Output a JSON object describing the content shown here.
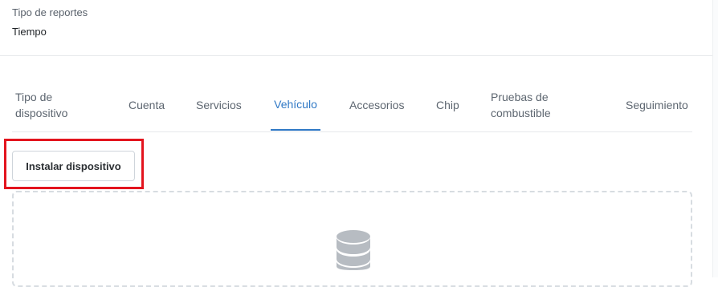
{
  "report": {
    "label": "Tipo de reportes",
    "value": "Tiempo"
  },
  "tabs": [
    {
      "label": "Tipo de\ndispositivo",
      "active": false
    },
    {
      "label": "Cuenta",
      "active": false
    },
    {
      "label": "Servicios",
      "active": false
    },
    {
      "label": "Vehículo",
      "active": true
    },
    {
      "label": "Accesorios",
      "active": false
    },
    {
      "label": "Chip",
      "active": false
    },
    {
      "label": "Pruebas de\ncombustible",
      "active": false
    },
    {
      "label": "Seguimiento",
      "active": false
    }
  ],
  "actions": {
    "install_label": "Instalar dispositivo"
  },
  "empty_state": {
    "icon": "database-icon"
  },
  "colors": {
    "accent": "#2f78c5",
    "highlight": "#e3141e",
    "text": "#2b2f33",
    "muted": "#5d6670",
    "border": "#e6e8eb",
    "dashed_border": "#d7dce1",
    "icon": "#b7bcc2"
  }
}
